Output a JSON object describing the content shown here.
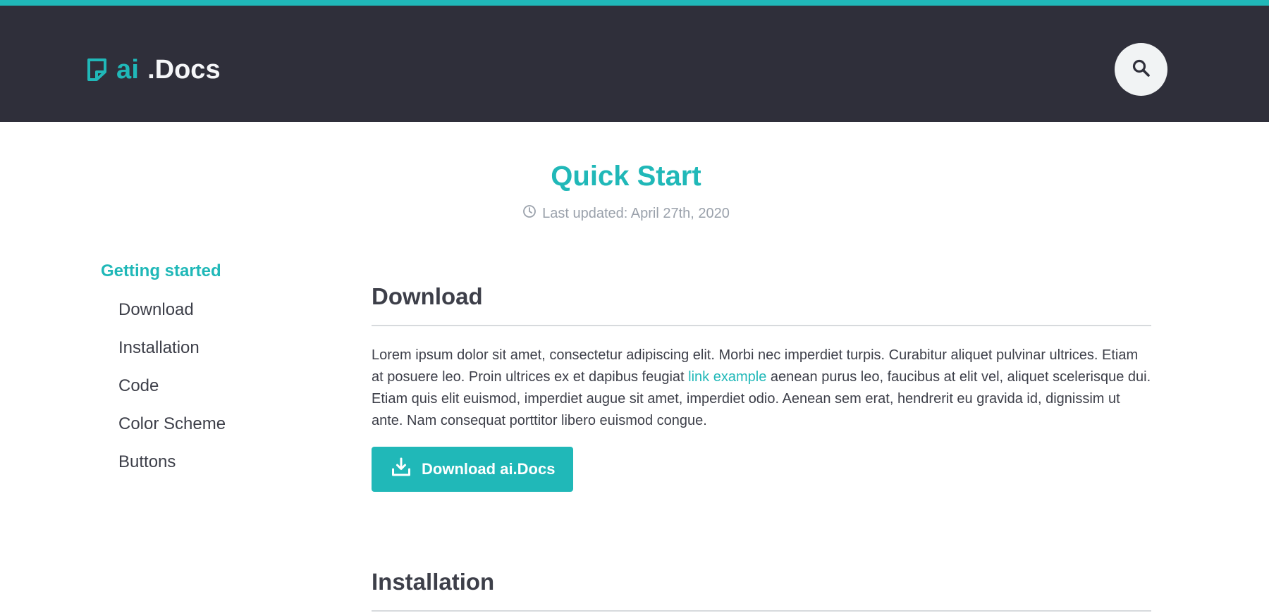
{
  "header": {
    "logo_ai": "ai",
    "logo_docs": ".Docs",
    "accent_color": "#20b8b8",
    "background_color": "#2f2f3a",
    "search_icon": "search-icon",
    "logo_icon": "document-icon"
  },
  "page": {
    "title": "Quick Start",
    "last_updated": "Last updated: April 27th, 2020",
    "clock_icon": "clock-icon"
  },
  "sidebar": {
    "heading": "Getting started",
    "items": [
      {
        "label": "Download"
      },
      {
        "label": "Installation"
      },
      {
        "label": "Code"
      },
      {
        "label": "Color Scheme"
      },
      {
        "label": "Buttons"
      }
    ]
  },
  "sections": {
    "download": {
      "title": "Download",
      "text_before": "Lorem ipsum dolor sit amet, consectetur adipiscing elit. Morbi nec imperdiet turpis. Curabitur aliquet pulvinar ultrices. Etiam at posuere leo. Proin ultrices ex et dapibus feugiat ",
      "link_text": "link example",
      "text_after": " aenean purus leo, faucibus at elit vel, aliquet scelerisque dui. Etiam quis elit euismod, imperdiet augue sit amet, imperdiet odio. Aenean sem erat, hendrerit eu gravida id, dignissim ut ante. Nam consequat porttitor libero euismod congue.",
      "button_label": "Download ai.Docs",
      "button_icon": "download-icon"
    },
    "installation": {
      "title": "Installation"
    }
  }
}
